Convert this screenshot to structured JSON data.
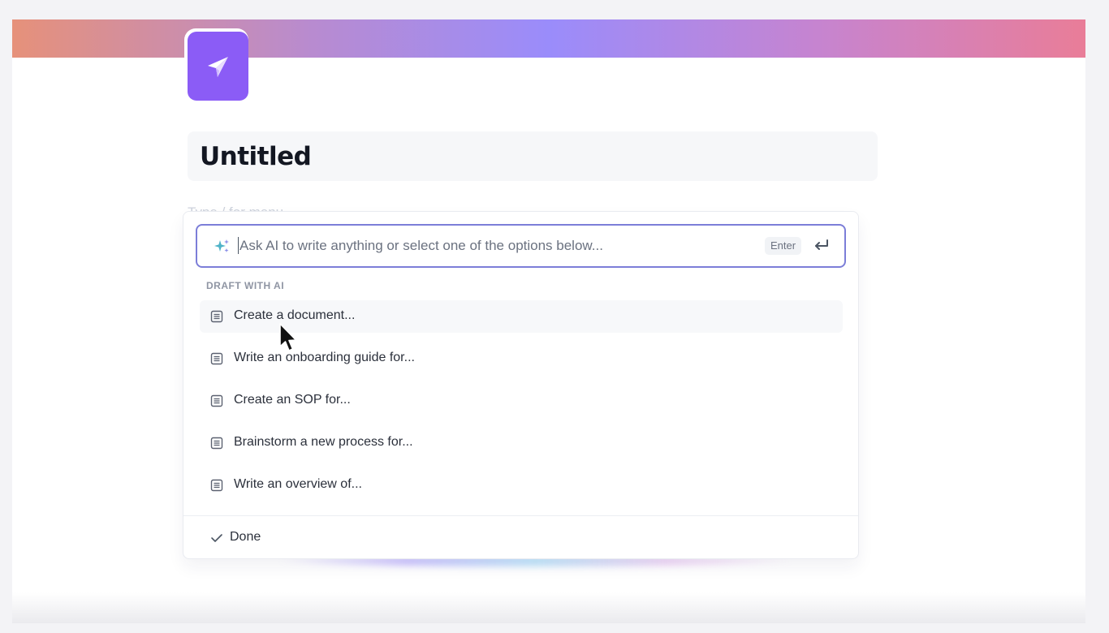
{
  "page": {
    "title": "Untitled",
    "placeholder": "Type / for menu",
    "icon": "paper-plane-icon"
  },
  "ai_prompt": {
    "placeholder": "Ask AI to write anything or select one of the options below...",
    "enter_label": "Enter",
    "icons": [
      "sparkle-icon",
      "enter-arrow-icon"
    ]
  },
  "menu": {
    "section_label": "DRAFT WITH AI",
    "items": [
      {
        "label": "Create a document...",
        "icon": "document-icon"
      },
      {
        "label": "Write an onboarding guide for...",
        "icon": "document-icon"
      },
      {
        "label": "Create an SOP for...",
        "icon": "document-icon"
      },
      {
        "label": "Brainstorm a new process for...",
        "icon": "document-icon"
      },
      {
        "label": "Write an overview of...",
        "icon": "document-icon"
      }
    ],
    "done_label": "Done"
  },
  "colors": {
    "accent": "#8b5cf6",
    "input_border": "#7c7ed8",
    "banner_start": "#e6917a",
    "banner_mid": "#9a8cfb",
    "banner_end": "#e97d98"
  }
}
